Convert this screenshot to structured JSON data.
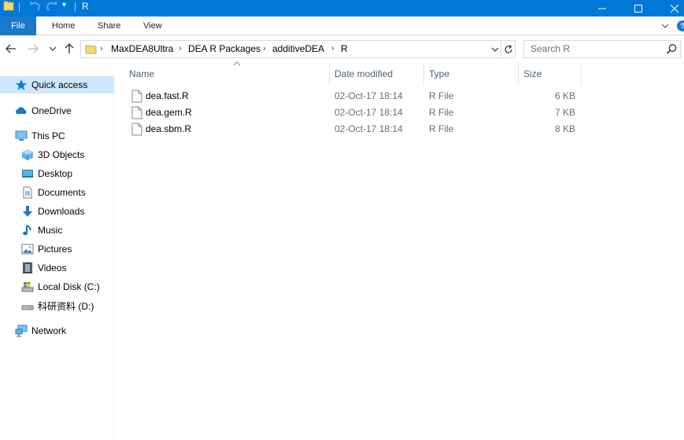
{
  "window": {
    "title": "R",
    "quick_access_toolbar": [
      "undo",
      "redo",
      "customize"
    ],
    "accent": "#0078d7"
  },
  "ribbon": {
    "tabs": [
      {
        "label": "File"
      },
      {
        "label": "Home"
      },
      {
        "label": "Share"
      },
      {
        "label": "View"
      }
    ]
  },
  "address": {
    "path": [
      "MaxDEA8Ultra",
      "DEA R Packages",
      "additiveDEA",
      "R"
    ]
  },
  "search": {
    "placeholder": "Search R"
  },
  "sidebar": {
    "items": [
      {
        "label": "Quick access",
        "icon": "star-icon",
        "selected": true
      },
      {
        "label": "OneDrive",
        "icon": "cloud-icon"
      },
      {
        "label": "This PC",
        "icon": "computer-icon"
      },
      {
        "label": "3D Objects",
        "icon": "cube-icon"
      },
      {
        "label": "Desktop",
        "icon": "desktop-icon"
      },
      {
        "label": "Documents",
        "icon": "document-icon"
      },
      {
        "label": "Downloads",
        "icon": "download-icon"
      },
      {
        "label": "Music",
        "icon": "music-icon"
      },
      {
        "label": "Pictures",
        "icon": "pictures-icon"
      },
      {
        "label": "Videos",
        "icon": "videos-icon"
      },
      {
        "label": "Local Disk (C:)",
        "icon": "disk-icon"
      },
      {
        "label": "科研资料 (D:)",
        "icon": "drive-icon"
      },
      {
        "label": "Network",
        "icon": "network-icon"
      }
    ]
  },
  "columns": {
    "name": "Name",
    "date": "Date modified",
    "type": "Type",
    "size": "Size"
  },
  "files": [
    {
      "name": "dea.fast.R",
      "date": "02-Oct-17 18:14",
      "type": "R File",
      "size": "6 KB"
    },
    {
      "name": "dea.gem.R",
      "date": "02-Oct-17 18:14",
      "type": "R File",
      "size": "7 KB"
    },
    {
      "name": "dea.sbm.R",
      "date": "02-Oct-17 18:14",
      "type": "R File",
      "size": "8 KB"
    }
  ]
}
